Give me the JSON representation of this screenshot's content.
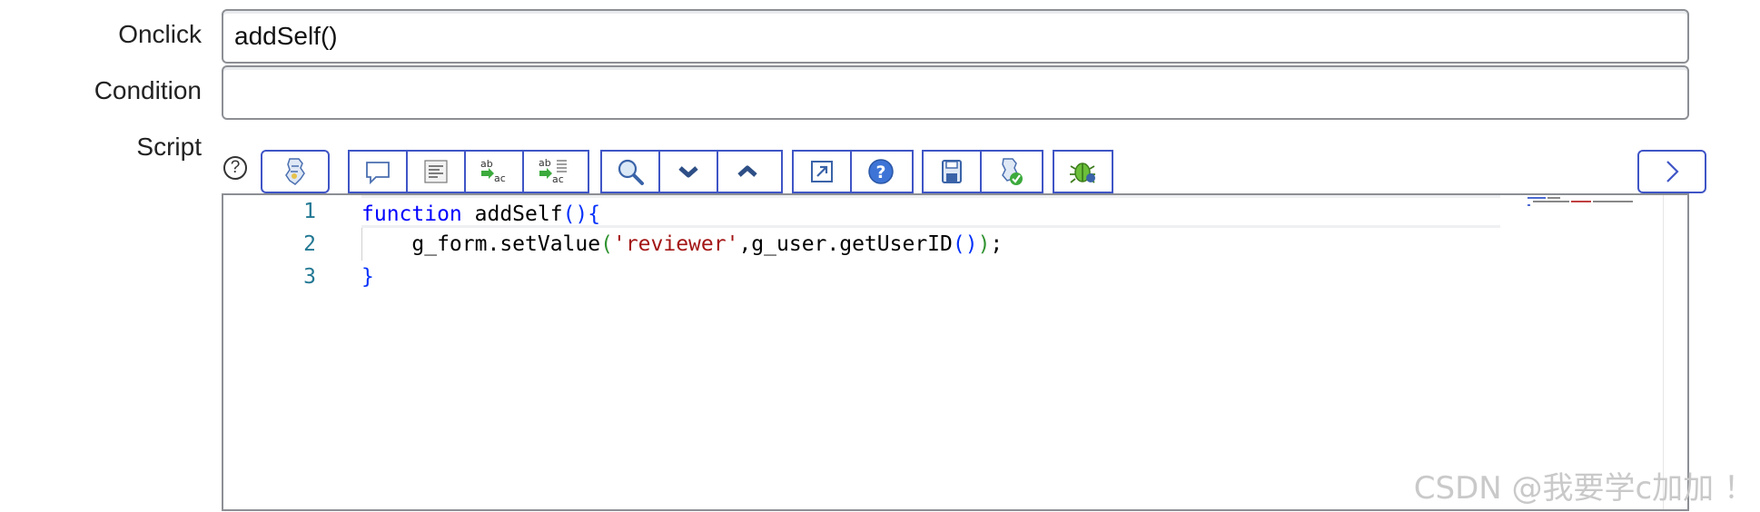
{
  "form": {
    "onclick": {
      "label": "Onclick",
      "value": "addSelf()"
    },
    "condition": {
      "label": "Condition",
      "value": ""
    },
    "script": {
      "label": "Script"
    }
  },
  "toolbar": {
    "help_glyph": "?",
    "icons": [
      "toggle-syntax-editor-icon",
      "comment-icon",
      "format-code-icon",
      "replace-icon",
      "replace-all-icon",
      "search-icon",
      "next-icon",
      "previous-icon",
      "fullscreen-icon",
      "help-icon",
      "save-icon",
      "check-syntax-icon",
      "script-debugger-icon",
      "expand-panel-icon"
    ]
  },
  "editor": {
    "line_numbers": [
      "1",
      "2",
      "3"
    ],
    "code": {
      "l1_kw": "function",
      "l1_name": " addSelf",
      "l1_paren": "()",
      "l1_brace": "{",
      "l2_indent": "    ",
      "l2_call": "g_form.setValue",
      "l2_open": "(",
      "l2_str": "'reviewer'",
      "l2_mid": ",g_user.getUserID",
      "l2_inner": "()",
      "l2_close": ")",
      "l2_end": ";",
      "l3_brace": "}"
    }
  },
  "watermark": "CSDN @我要学c加加 ！",
  "colors": {
    "accent": "#3f55c6",
    "keyword": "#0000ff",
    "string": "#a31515",
    "line_number": "#237893"
  }
}
